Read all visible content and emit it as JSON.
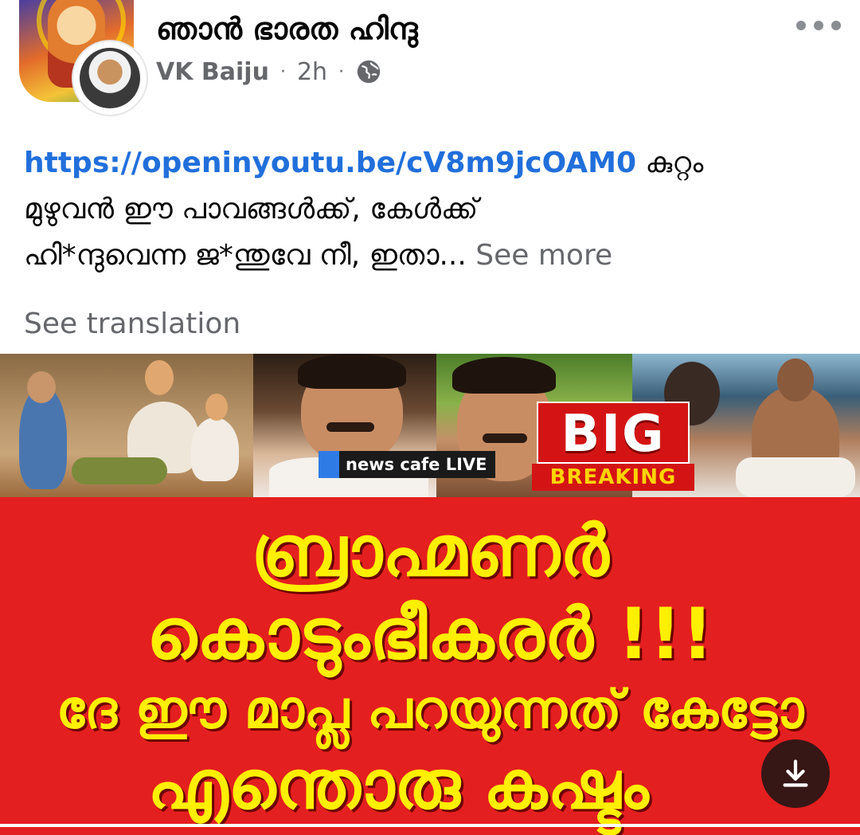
{
  "post": {
    "group_name": "ഞാൻ ഭാരത ഹിന്ദു",
    "author": "VK Baiju",
    "time": "2h",
    "separator": "·",
    "privacy_icon": "globe-icon",
    "more_icon": "more-horizontal-icon",
    "link": "https://openinyoutu.be/cV8m9jcOAM0",
    "body_line1": " കുറ്റം",
    "body_line2": "മുഴുവൻ ഈ പാവങ്ങൾക്ക്, കേൾക്ക്",
    "body_line3": "ഹി*ന്ദുവെന്ന ജ*ന്തുവേ നീ, ഇതാ...",
    "see_more": "See more",
    "see_translation": "See translation"
  },
  "image": {
    "news_tag": "news cafe LIVE",
    "big": "BIG",
    "breaking": "BREAKING",
    "headline1": "ബ്രാഹ്മണർ",
    "headline2": "കൊടുംഭീകരർ !!!",
    "headline3": "ദേ ഈ മാപ്ല പറയുന്നത് കേട്ടോ",
    "headline4": "എന്തൊരു കഷ്ടം",
    "download_icon": "download-icon"
  },
  "colors": {
    "link": "#216fdb",
    "muted": "#65676b",
    "banner_red": "#e41f1f",
    "headline_yellow": "#ffef00"
  }
}
